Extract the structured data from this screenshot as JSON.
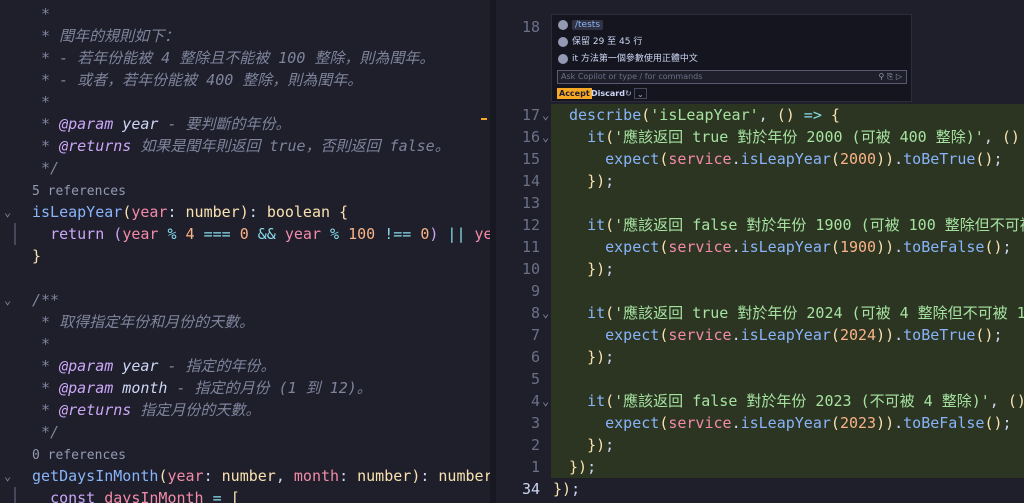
{
  "left": {
    "lines": [
      {
        "type": "comment",
        "parts": [
          {
            "c": "cm",
            "t": " *"
          }
        ]
      },
      {
        "type": "comment",
        "parts": [
          {
            "c": "cm",
            "t": " * 閏年的規則如下："
          }
        ]
      },
      {
        "type": "comment",
        "parts": [
          {
            "c": "cm",
            "t": " * - 若年份能被 4 整除且不能被 100 整除，則為閏年。"
          }
        ]
      },
      {
        "type": "comment",
        "parts": [
          {
            "c": "cm",
            "t": " * - 或者，若年份能被 400 整除，則為閏年。"
          }
        ]
      },
      {
        "type": "comment",
        "parts": [
          {
            "c": "cm",
            "t": " *"
          }
        ]
      },
      {
        "type": "comment",
        "parts": [
          {
            "c": "cm",
            "t": " * "
          },
          {
            "c": "cmk",
            "t": "@param"
          },
          {
            "c": "cmp",
            "t": " year"
          },
          {
            "c": "cm",
            "t": " - 要判斷的年份。"
          }
        ]
      },
      {
        "type": "comment",
        "parts": [
          {
            "c": "cm",
            "t": " * "
          },
          {
            "c": "cmk",
            "t": "@returns"
          },
          {
            "c": "cm",
            "t": " 如果是閏年則返回 true，否則返回 false。"
          }
        ]
      },
      {
        "type": "comment",
        "parts": [
          {
            "c": "cm",
            "t": " */"
          }
        ]
      },
      {
        "type": "ref",
        "parts": [
          {
            "c": "ref",
            "t": "5 references"
          }
        ]
      },
      {
        "type": "code",
        "fold": true,
        "parts": [
          {
            "c": "fn",
            "t": "isLeapYear"
          },
          {
            "c": "br",
            "t": "("
          },
          {
            "c": "var",
            "t": "year"
          },
          {
            "c": "pl",
            "t": ": "
          },
          {
            "c": "ty",
            "t": "number"
          },
          {
            "c": "br",
            "t": ")"
          },
          {
            "c": "pl",
            "t": ": "
          },
          {
            "c": "ty",
            "t": "boolean"
          },
          {
            "c": "pl",
            "t": " "
          },
          {
            "c": "br",
            "t": "{"
          }
        ]
      },
      {
        "type": "code",
        "parts": [
          {
            "c": "pl",
            "t": "  "
          },
          {
            "c": "kw",
            "t": "return"
          },
          {
            "c": "pl",
            "t": " "
          },
          {
            "c": "kw",
            "t": "("
          },
          {
            "c": "var",
            "t": "year"
          },
          {
            "c": "op",
            "t": " % "
          },
          {
            "c": "num",
            "t": "4"
          },
          {
            "c": "op",
            "t": " === "
          },
          {
            "c": "num",
            "t": "0"
          },
          {
            "c": "op",
            "t": " && "
          },
          {
            "c": "var",
            "t": "year"
          },
          {
            "c": "op",
            "t": " % "
          },
          {
            "c": "num",
            "t": "100"
          },
          {
            "c": "op",
            "t": " !== "
          },
          {
            "c": "num",
            "t": "0"
          },
          {
            "c": "kw",
            "t": ")"
          },
          {
            "c": "op",
            "t": " || "
          },
          {
            "c": "var",
            "t": "ye"
          }
        ]
      },
      {
        "type": "code",
        "parts": [
          {
            "c": "br",
            "t": "}"
          }
        ]
      },
      {
        "type": "blank",
        "parts": []
      },
      {
        "type": "comment",
        "fold": true,
        "parts": [
          {
            "c": "cm",
            "t": "/**"
          }
        ]
      },
      {
        "type": "comment",
        "parts": [
          {
            "c": "cm",
            "t": " * 取得指定年份和月份的天數。"
          }
        ]
      },
      {
        "type": "comment",
        "parts": [
          {
            "c": "cm",
            "t": " *"
          }
        ]
      },
      {
        "type": "comment",
        "parts": [
          {
            "c": "cm",
            "t": " * "
          },
          {
            "c": "cmk",
            "t": "@param"
          },
          {
            "c": "cmp",
            "t": " year"
          },
          {
            "c": "cm",
            "t": " - 指定的年份。"
          }
        ]
      },
      {
        "type": "comment",
        "parts": [
          {
            "c": "cm",
            "t": " * "
          },
          {
            "c": "cmk",
            "t": "@param"
          },
          {
            "c": "cmp",
            "t": " month"
          },
          {
            "c": "cm",
            "t": " - 指定的月份 (1 到 12)。"
          }
        ]
      },
      {
        "type": "comment",
        "parts": [
          {
            "c": "cm",
            "t": " * "
          },
          {
            "c": "cmk",
            "t": "@returns"
          },
          {
            "c": "cm",
            "t": " 指定月份的天數。"
          }
        ]
      },
      {
        "type": "comment",
        "parts": [
          {
            "c": "cm",
            "t": " */"
          }
        ]
      },
      {
        "type": "ref",
        "parts": [
          {
            "c": "ref",
            "t": "0 references"
          }
        ]
      },
      {
        "type": "code",
        "fold": true,
        "parts": [
          {
            "c": "fn",
            "t": "getDaysInMonth"
          },
          {
            "c": "br",
            "t": "("
          },
          {
            "c": "var",
            "t": "year"
          },
          {
            "c": "pl",
            "t": ": "
          },
          {
            "c": "ty",
            "t": "number"
          },
          {
            "c": "pl",
            "t": ", "
          },
          {
            "c": "var",
            "t": "month"
          },
          {
            "c": "pl",
            "t": ": "
          },
          {
            "c": "ty",
            "t": "number"
          },
          {
            "c": "br",
            "t": ")"
          },
          {
            "c": "pl",
            "t": ": "
          },
          {
            "c": "ty",
            "t": "number"
          }
        ]
      },
      {
        "type": "code",
        "parts": [
          {
            "c": "pl",
            "t": "  "
          },
          {
            "c": "kw",
            "t": "const"
          },
          {
            "c": "pl",
            "t": " "
          },
          {
            "c": "var",
            "t": "daysInMonth"
          },
          {
            "c": "op",
            "t": " = "
          },
          {
            "c": "br",
            "t": "["
          }
        ]
      }
    ]
  },
  "right": {
    "top_line_number": "18",
    "lines": [
      {
        "n": "17",
        "diff": true,
        "fold": true,
        "parts": [
          {
            "c": "fn",
            "t": "describe"
          },
          {
            "c": "br",
            "t": "("
          },
          {
            "c": "str",
            "t": "'isLeapYear'"
          },
          {
            "c": "pl",
            "t": ", "
          },
          {
            "c": "br",
            "t": "()"
          },
          {
            "c": "op",
            "t": " => "
          },
          {
            "c": "br",
            "t": "{"
          }
        ]
      },
      {
        "n": "16",
        "diff": true,
        "fold": true,
        "parts": [
          {
            "c": "pl",
            "t": "  "
          },
          {
            "c": "fn",
            "t": "it"
          },
          {
            "c": "br",
            "t": "("
          },
          {
            "c": "str",
            "t": "'應該返回 true 對於年份 2000 (可被 400 整除)'"
          },
          {
            "c": "pl",
            "t": ", "
          },
          {
            "c": "br",
            "t": "()"
          }
        ]
      },
      {
        "n": "15",
        "diff": true,
        "parts": [
          {
            "c": "pl",
            "t": "    "
          },
          {
            "c": "fn",
            "t": "expect"
          },
          {
            "c": "br",
            "t": "("
          },
          {
            "c": "var",
            "t": "service"
          },
          {
            "c": "pl",
            "t": "."
          },
          {
            "c": "fn",
            "t": "isLeapYear"
          },
          {
            "c": "br",
            "t": "("
          },
          {
            "c": "num",
            "t": "2000"
          },
          {
            "c": "br",
            "t": "))"
          },
          {
            "c": "pl",
            "t": "."
          },
          {
            "c": "fn",
            "t": "toBeTrue"
          },
          {
            "c": "br",
            "t": "()"
          },
          {
            "c": "pl",
            "t": ";"
          }
        ]
      },
      {
        "n": "14",
        "diff": true,
        "parts": [
          {
            "c": "pl",
            "t": "  "
          },
          {
            "c": "br",
            "t": "})"
          },
          {
            "c": "pl",
            "t": ";"
          }
        ]
      },
      {
        "n": "13",
        "diff": true,
        "parts": []
      },
      {
        "n": "12",
        "diff": true,
        "parts": [
          {
            "c": "pl",
            "t": "  "
          },
          {
            "c": "fn",
            "t": "it"
          },
          {
            "c": "br",
            "t": "("
          },
          {
            "c": "str",
            "t": "'應該返回 false 對於年份 1900 (可被 100 整除但不可被"
          }
        ]
      },
      {
        "n": "11",
        "diff": true,
        "parts": [
          {
            "c": "pl",
            "t": "    "
          },
          {
            "c": "fn",
            "t": "expect"
          },
          {
            "c": "br",
            "t": "("
          },
          {
            "c": "var",
            "t": "service"
          },
          {
            "c": "pl",
            "t": "."
          },
          {
            "c": "fn",
            "t": "isLeapYear"
          },
          {
            "c": "br",
            "t": "("
          },
          {
            "c": "num",
            "t": "1900"
          },
          {
            "c": "br",
            "t": "))"
          },
          {
            "c": "pl",
            "t": "."
          },
          {
            "c": "fn",
            "t": "toBeFalse"
          },
          {
            "c": "br",
            "t": "()"
          },
          {
            "c": "pl",
            "t": ";"
          }
        ]
      },
      {
        "n": "10",
        "diff": true,
        "parts": [
          {
            "c": "pl",
            "t": "  "
          },
          {
            "c": "br",
            "t": "})"
          },
          {
            "c": "pl",
            "t": ";"
          }
        ]
      },
      {
        "n": "9",
        "diff": true,
        "parts": []
      },
      {
        "n": "8",
        "diff": true,
        "fold": true,
        "parts": [
          {
            "c": "pl",
            "t": "  "
          },
          {
            "c": "fn",
            "t": "it"
          },
          {
            "c": "br",
            "t": "("
          },
          {
            "c": "str",
            "t": "'應該返回 true 對於年份 2024 (可被 4 整除但不可被 10"
          }
        ]
      },
      {
        "n": "7",
        "diff": true,
        "parts": [
          {
            "c": "pl",
            "t": "    "
          },
          {
            "c": "fn",
            "t": "expect"
          },
          {
            "c": "br",
            "t": "("
          },
          {
            "c": "var",
            "t": "service"
          },
          {
            "c": "pl",
            "t": "."
          },
          {
            "c": "fn",
            "t": "isLeapYear"
          },
          {
            "c": "br",
            "t": "("
          },
          {
            "c": "num",
            "t": "2024"
          },
          {
            "c": "br",
            "t": "))"
          },
          {
            "c": "pl",
            "t": "."
          },
          {
            "c": "fn",
            "t": "toBeTrue"
          },
          {
            "c": "br",
            "t": "()"
          },
          {
            "c": "pl",
            "t": ";"
          }
        ]
      },
      {
        "n": "6",
        "diff": true,
        "parts": [
          {
            "c": "pl",
            "t": "  "
          },
          {
            "c": "br",
            "t": "})"
          },
          {
            "c": "pl",
            "t": ";"
          }
        ]
      },
      {
        "n": "5",
        "diff": true,
        "parts": []
      },
      {
        "n": "4",
        "diff": true,
        "fold": true,
        "parts": [
          {
            "c": "pl",
            "t": "  "
          },
          {
            "c": "fn",
            "t": "it"
          },
          {
            "c": "br",
            "t": "("
          },
          {
            "c": "str",
            "t": "'應該返回 false 對於年份 2023 (不可被 4 整除)'"
          },
          {
            "c": "pl",
            "t": ", "
          },
          {
            "c": "br",
            "t": "()"
          }
        ]
      },
      {
        "n": "3",
        "diff": true,
        "parts": [
          {
            "c": "pl",
            "t": "    "
          },
          {
            "c": "fn",
            "t": "expect"
          },
          {
            "c": "br",
            "t": "("
          },
          {
            "c": "var",
            "t": "service"
          },
          {
            "c": "pl",
            "t": "."
          },
          {
            "c": "fn",
            "t": "isLeapYear"
          },
          {
            "c": "br",
            "t": "("
          },
          {
            "c": "num",
            "t": "2023"
          },
          {
            "c": "br",
            "t": "))"
          },
          {
            "c": "pl",
            "t": "."
          },
          {
            "c": "fn",
            "t": "toBeFalse"
          },
          {
            "c": "br",
            "t": "()"
          },
          {
            "c": "pl",
            "t": ";"
          }
        ]
      },
      {
        "n": "2",
        "diff": true,
        "parts": [
          {
            "c": "pl",
            "t": "  "
          },
          {
            "c": "br",
            "t": "})"
          },
          {
            "c": "pl",
            "t": ";"
          }
        ]
      },
      {
        "n": "1",
        "diff": true,
        "parts": [
          {
            "c": "br",
            "t": "})"
          },
          {
            "c": "pl",
            "t": ";"
          }
        ]
      },
      {
        "n": "34",
        "diff": false,
        "current": true,
        "parts": [
          {
            "c": "br",
            "t": "})"
          },
          {
            "c": "pl",
            "t": ";"
          }
        ]
      }
    ]
  },
  "copilot": {
    "items": [
      {
        "label": "/tests",
        "link": true
      },
      {
        "label": "保留 29 至 45 行",
        "link": false
      },
      {
        "label": "it 方法第一個參數使用正體中文",
        "link": false
      }
    ],
    "input_placeholder": "Ask Copilot or type / for commands",
    "input_icons": "⚲ ⎘ ▷",
    "accept_label": "Accept",
    "discard_label": "Discard",
    "retry_icon": "↻",
    "more_icon": "⌄"
  },
  "colors": {
    "accent": "#f9a825",
    "diff_bg": "#2c3522",
    "editor_bg": "#1e1f2b"
  },
  "icons": [
    "fold-chevron-icon",
    "user-avatar-icon",
    "mic-icon",
    "attach-icon",
    "send-icon",
    "retry-icon",
    "chevron-down-icon"
  ]
}
